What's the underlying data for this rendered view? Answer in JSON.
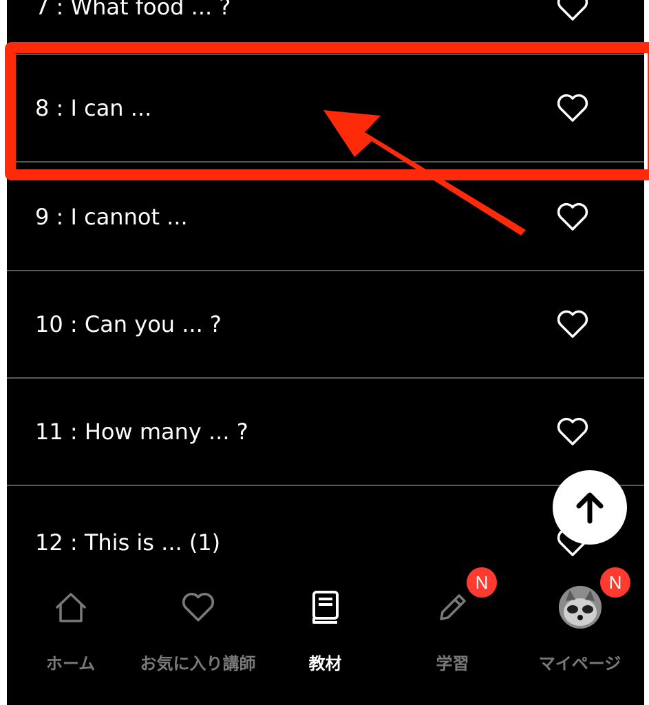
{
  "lessons": [
    {
      "label": "7 : What food ... ?"
    },
    {
      "label": "8 : I can ..."
    },
    {
      "label": "9 : I cannot ..."
    },
    {
      "label": "10 : Can you ... ?"
    },
    {
      "label": "11 : How many ... ?"
    },
    {
      "label": "12 : This is ... (1)"
    }
  ],
  "icons": {
    "favorite": "heart-outline-icon",
    "scroll_top": "arrow-up-icon"
  },
  "tabbar": {
    "tabs": [
      {
        "label": "ホーム",
        "icon": "home-icon"
      },
      {
        "label": "お気に入り講師",
        "icon": "heart-icon"
      },
      {
        "label": "教材",
        "icon": "book-icon",
        "active": true
      },
      {
        "label": "学習",
        "icon": "pencil-icon",
        "badge": "N"
      },
      {
        "label": "マイページ",
        "icon": "avatar",
        "badge": "N"
      }
    ]
  },
  "colors": {
    "background": "#000000",
    "highlight": "#ff2a0a",
    "badge": "#ff3b30",
    "inactive_tab": "#7a7a7a",
    "active_tab": "#ffffff"
  }
}
